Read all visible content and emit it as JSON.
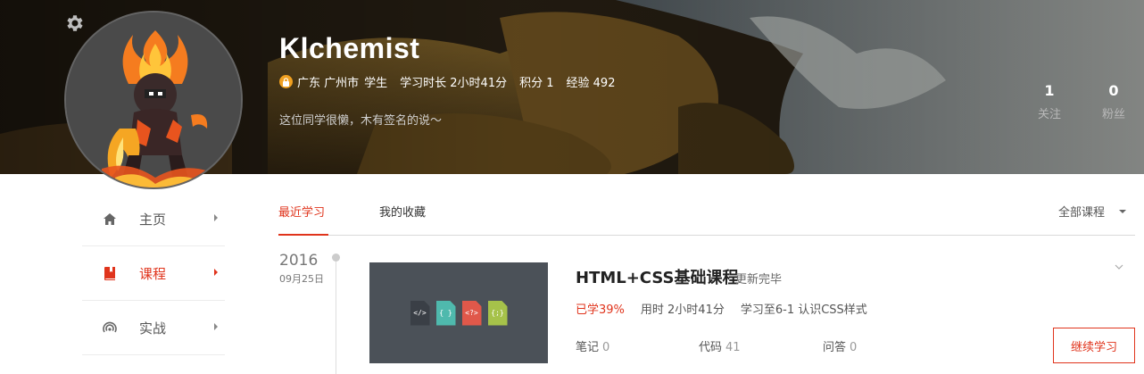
{
  "profile": {
    "username": "Klchemist",
    "location": "广东 广州市",
    "role": "学生",
    "study_time": "学习时长 2小时41分",
    "points": "积分 1",
    "experience": "经验 492",
    "signature": "这位同学很懒，木有签名的说～",
    "following_count": "1",
    "following_label": "关注",
    "followers_count": "0",
    "followers_label": "粉丝"
  },
  "sidebar": {
    "items": [
      {
        "label": "主页",
        "icon": "home-icon",
        "active": false
      },
      {
        "label": "课程",
        "icon": "book-icon",
        "active": true
      },
      {
        "label": "实战",
        "icon": "practice-icon",
        "active": false
      }
    ]
  },
  "tabs": {
    "items": [
      {
        "label": "最近学习",
        "active": true
      },
      {
        "label": "我的收藏",
        "active": false
      }
    ],
    "filter": "全部课程"
  },
  "course": {
    "year": "2016",
    "date": "09月25日",
    "title": "HTML+CSS基础课程",
    "status": "更新完毕",
    "progress": "已学39%",
    "time_used": "用时 2小时41分",
    "learned_to": "学习至6-1 认识CSS样式",
    "notes_label": "笔记",
    "notes_count": "0",
    "code_label": "代码",
    "code_count": "41",
    "qa_label": "问答",
    "qa_count": "0",
    "continue_label": "继续学习",
    "thumb_icons": [
      "</>",
      "{ }",
      "<?>",
      "{;}"
    ]
  },
  "colors": {
    "accent": "#e0341c",
    "thumb_bg": "#4b5158",
    "file_colors": [
      "#3a3f46",
      "#4fb9ad",
      "#e0584a",
      "#a6c24a"
    ]
  }
}
